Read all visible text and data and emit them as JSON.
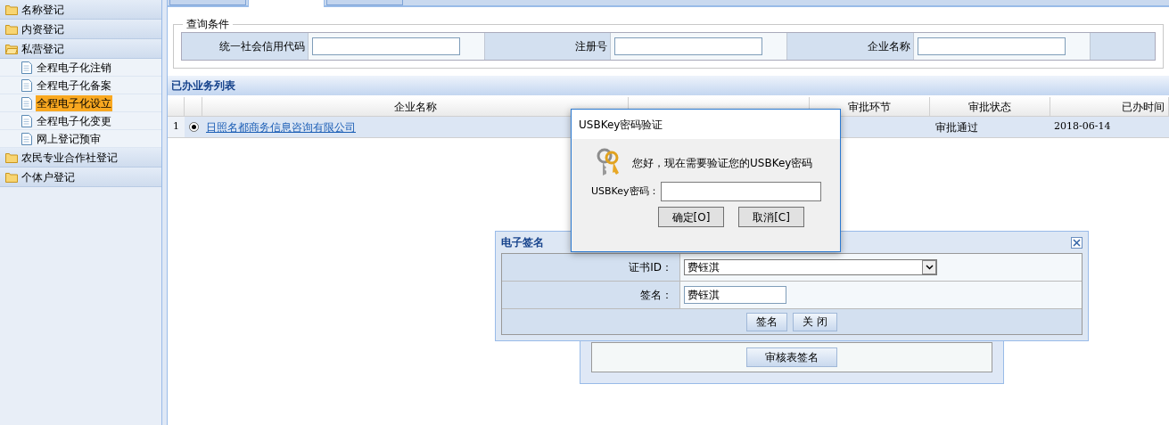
{
  "sidebar": {
    "groups": [
      {
        "label": "名称登记",
        "expanded": false
      },
      {
        "label": "内资登记",
        "expanded": false
      },
      {
        "label": "私营登记",
        "expanded": true,
        "children": [
          {
            "label": "全程电子化注销",
            "selected": false
          },
          {
            "label": "全程电子化备案",
            "selected": false
          },
          {
            "label": "全程电子化设立",
            "selected": true
          },
          {
            "label": "全程电子化变更",
            "selected": false
          },
          {
            "label": "网上登记预审",
            "selected": false
          }
        ]
      },
      {
        "label": "农民专业合作社登记",
        "expanded": false
      },
      {
        "label": "个体户登记",
        "expanded": false
      }
    ]
  },
  "tabs": [
    {
      "selected": false
    },
    {
      "selected": true
    },
    {
      "selected": false
    }
  ],
  "query": {
    "legend": "查询条件",
    "fields": [
      {
        "label": "统一社会信用代码"
      },
      {
        "label": "注册号"
      },
      {
        "label": "企业名称"
      }
    ]
  },
  "table": {
    "title": "已办业务列表",
    "columns": [
      "企业名称",
      null,
      "审批环节",
      "审批状态",
      "已办时间"
    ],
    "rows": [
      {
        "index": "1",
        "selected": true,
        "company": "日照名都商务信息咨询有限公司",
        "status": "审批通过",
        "date": "2018-06-14"
      }
    ]
  },
  "back_panel": {
    "button": "审核表签名"
  },
  "signature_dialog": {
    "title": "电子签名",
    "cert_label": "证书ID：",
    "cert_value": "费钰淇",
    "sign_label": "签名：",
    "sign_value": "费钰淇",
    "buttons": [
      "签名",
      "关 闭"
    ]
  },
  "usbkey_dialog": {
    "title": "USBKey密码验证",
    "message": "您好，现在需要验证您的USBKey密码",
    "password_label": "USBKey密码：",
    "buttons": [
      "确定[O]",
      "取消[C]"
    ]
  }
}
